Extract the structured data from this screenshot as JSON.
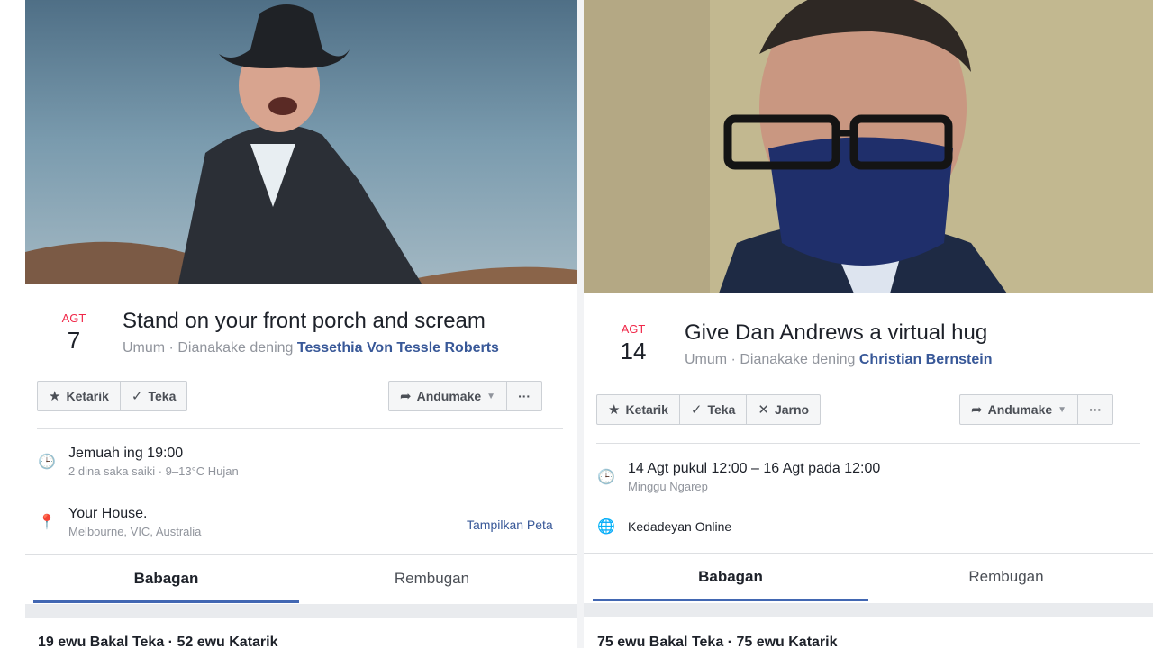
{
  "left": {
    "date": {
      "month": "AGT",
      "day": "7"
    },
    "title": "Stand on your front porch and scream",
    "subtitle_prefix": "Umum · Dianakake dening",
    "host": "Tessethia Von Tessle Roberts",
    "buttons": {
      "interested": "Ketarik",
      "going": "Teka",
      "share": "Andumake",
      "more": "···"
    },
    "time_main": "Jemuah ing 19:00",
    "time_sub": "2 dina saka saiki · 9–13°C Hujan",
    "place_main": "Your House.",
    "place_sub": "Melbourne, VIC, Australia",
    "map_link": "Tampilkan Peta",
    "tabs": [
      "Babagan",
      "Rembugan"
    ],
    "stats": "19 ewu Bakal Teka · 52 ewu Katarik"
  },
  "right": {
    "date": {
      "month": "AGT",
      "day": "14"
    },
    "title": "Give Dan Andrews a virtual hug",
    "subtitle_prefix": "Umum · Dianakake dening",
    "host": "Christian Bernstein",
    "buttons": {
      "interested": "Ketarik",
      "going": "Teka",
      "cant": "Jarno",
      "share": "Andumake",
      "more": "···"
    },
    "time_main": "14 Agt pukul 12:00 – 16 Agt pada 12:00",
    "time_sub": "Minggu Ngarep",
    "online": "Kedadeyan Online",
    "tabs": [
      "Babagan",
      "Rembugan"
    ],
    "stats": "75 ewu Bakal Teka · 75 ewu Katarik"
  },
  "colors": {
    "accent": "#4267b2",
    "link": "#385898",
    "date_red": "#f02849"
  }
}
